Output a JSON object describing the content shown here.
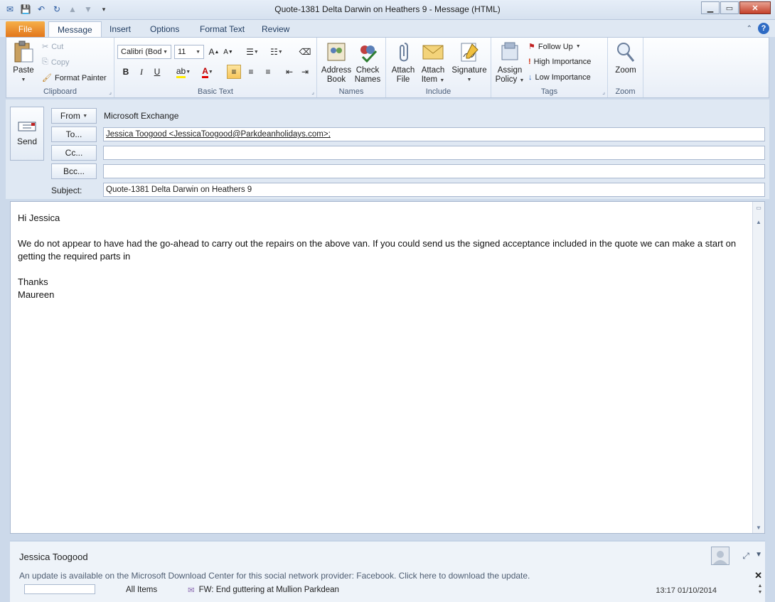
{
  "window": {
    "title": "Quote-1381  Delta Darwin on Heathers 9  -  Message (HTML)"
  },
  "ribbon_tabs": [
    {
      "label": "File"
    },
    {
      "label": "Message"
    },
    {
      "label": "Insert"
    },
    {
      "label": "Options"
    },
    {
      "label": "Format Text"
    },
    {
      "label": "Review"
    }
  ],
  "clipboard": {
    "paste": "Paste",
    "cut": "Cut",
    "copy": "Copy",
    "format_painter": "Format Painter",
    "group": "Clipboard"
  },
  "basic_text": {
    "font": "Calibri (Bod",
    "size": "11",
    "group": "Basic Text"
  },
  "names": {
    "address_book_1": "Address",
    "address_book_2": "Book",
    "check_names_1": "Check",
    "check_names_2": "Names",
    "group": "Names"
  },
  "include": {
    "attach_file_1": "Attach",
    "attach_file_2": "File",
    "attach_item_1": "Attach",
    "attach_item_2": "Item",
    "signature": "Signature",
    "group": "Include"
  },
  "tags": {
    "assign_policy_1": "Assign",
    "assign_policy_2": "Policy",
    "follow_up": "Follow Up",
    "high_importance": "High Importance",
    "low_importance": "Low Importance",
    "group": "Tags"
  },
  "zoom": {
    "label": "Zoom",
    "group": "Zoom"
  },
  "header": {
    "send": "Send",
    "from_button": "From",
    "from_value": "Microsoft Exchange",
    "to_button": "To...",
    "to_value": "Jessica Toogood <JessicaToogood@Parkdeanholidays.com>;",
    "cc_button": "Cc...",
    "cc_value": "",
    "bcc_button": "Bcc...",
    "bcc_value": "",
    "subject_label": "Subject:",
    "subject_value": "Quote-1381  Delta Darwin on Heathers 9"
  },
  "body": {
    "greeting": "Hi Jessica",
    "paragraph": "We do not appear to have had the go-ahead to carry out the repairs on the above van.  If you could send us the signed acceptance included in the quote we can make a start on getting the required parts in",
    "thanks": "Thanks",
    "signature": "Maureen"
  },
  "people_pane": {
    "name": "Jessica Toogood",
    "notice": "An update is available on the Microsoft Download Center for this social network provider: Facebook. Click here to download the update.",
    "all_items": "All Items",
    "item_subject": "FW: End guttering at Mullion Parkdean",
    "item_date": "13:17  01/10/2014"
  }
}
